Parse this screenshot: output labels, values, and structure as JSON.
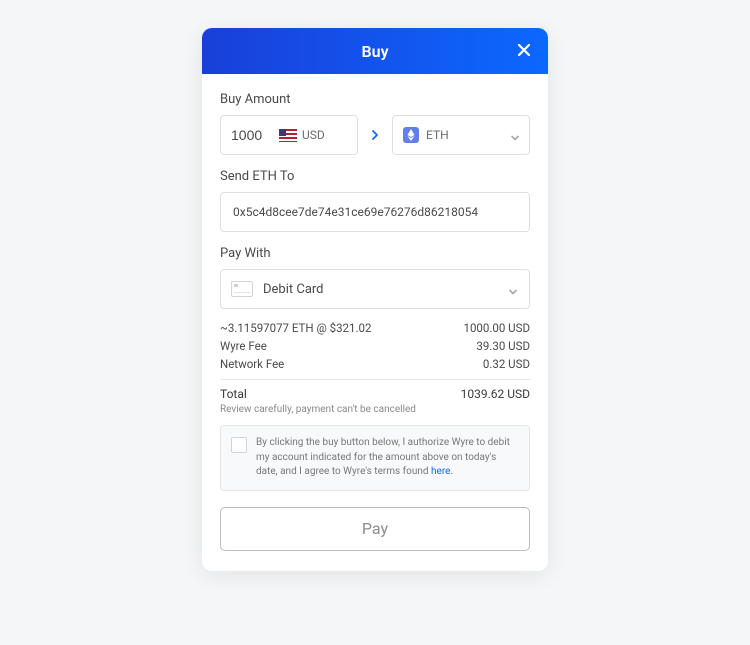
{
  "header": {
    "title": "Buy"
  },
  "buy_amount": {
    "label": "Buy Amount",
    "value": "1000",
    "source_currency": "USD",
    "target_currency": "ETH"
  },
  "send_to": {
    "label": "Send ETH To",
    "address": "0x5c4d8cee7de74e31ce69e76276d86218054"
  },
  "pay_with": {
    "label": "Pay With",
    "method": "Debit Card"
  },
  "summary": {
    "rate_line": "~3.11597077 ETH @ $321.02",
    "amount": "1000.00 USD",
    "wyre_fee_label": "Wyre Fee",
    "wyre_fee": "39.30 USD",
    "network_fee_label": "Network Fee",
    "network_fee": "0.32 USD",
    "total_label": "Total",
    "total": "1039.62 USD"
  },
  "review": {
    "note": "Review carefully, payment can't be cancelled",
    "auth_text": "By clicking the buy button below, I authorize Wyre to debit my account indicated for the amount above on today's date, and I agree to Wyre's terms found ",
    "terms_link_text": "here"
  },
  "actions": {
    "pay_label": "Pay"
  }
}
